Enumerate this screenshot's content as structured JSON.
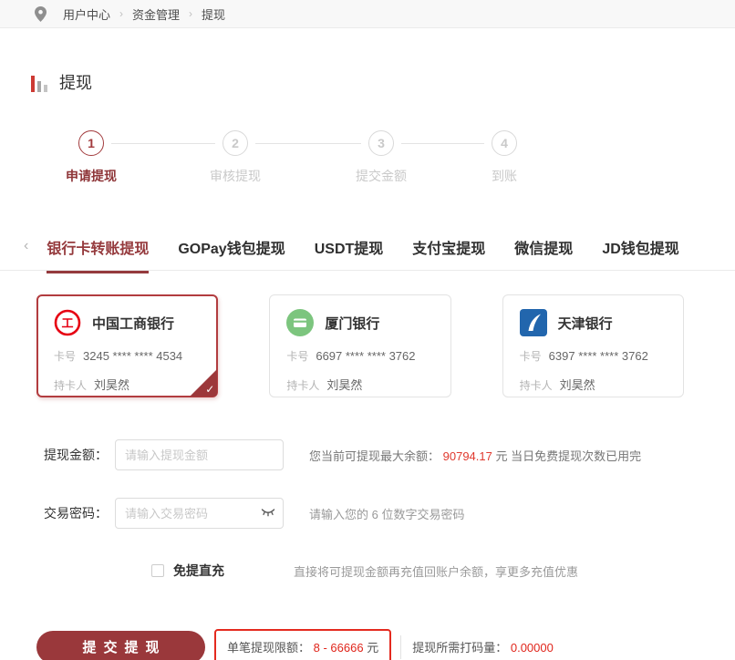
{
  "breadcrumb": {
    "items": [
      "用户中心",
      "资金管理",
      "提现"
    ],
    "separator": "›"
  },
  "page": {
    "title": "提现"
  },
  "stepper": {
    "steps": [
      {
        "num": "1",
        "label": "申请提现",
        "active": true
      },
      {
        "num": "2",
        "label": "审核提现",
        "active": false
      },
      {
        "num": "3",
        "label": "提交金额",
        "active": false
      },
      {
        "num": "4",
        "label": "到账",
        "active": false
      }
    ]
  },
  "tabs": {
    "back_arrow": "‹",
    "items": [
      {
        "label": "银行卡转账提现",
        "active": true
      },
      {
        "label": "GOPay钱包提现",
        "active": false
      },
      {
        "label": "USDT提现",
        "active": false
      },
      {
        "label": "支付宝提现",
        "active": false
      },
      {
        "label": "微信提现",
        "active": false
      },
      {
        "label": "JD钱包提现",
        "active": false
      }
    ]
  },
  "cards": [
    {
      "bank": "中国工商银行",
      "number_label": "卡号",
      "number": "3245 **** **** 4534",
      "holder_label": "持卡人",
      "holder": "刘昊然",
      "selected": true,
      "logo_color": "#e60012"
    },
    {
      "bank": "厦门银行",
      "number_label": "卡号",
      "number": "6697 **** **** 3762",
      "holder_label": "持卡人",
      "holder": "刘昊然",
      "selected": false,
      "logo_color": "#7cc57e"
    },
    {
      "bank": "天津银行",
      "number_label": "卡号",
      "number": "6397 **** **** 3762",
      "holder_label": "持卡人",
      "holder": "刘昊然",
      "selected": false,
      "logo_color": "#2266ad"
    }
  ],
  "check_glyph": "✓",
  "form": {
    "amount": {
      "label": "提现金额：",
      "placeholder": "请输入提现金额",
      "hint_prefix": "您当前可提现最大余额：",
      "hint_value": "90794.17",
      "hint_suffix": "元 当日免费提现次数已用完"
    },
    "password": {
      "label": "交易密码：",
      "placeholder": "请输入交易密码",
      "hint": "请输入您的 6 位数字交易密码"
    },
    "consent": {
      "label": "免提直充",
      "hint": "直接将可提现金额再充值回账户余额，享更多充值优惠",
      "checked": false
    }
  },
  "footer": {
    "submit_label": "提交提现",
    "limit_label": "单笔提现限额：",
    "limit_value": "8 - 66666",
    "limit_unit": "元",
    "code_label": "提现所需打码量：",
    "code_value": "0.00000"
  },
  "colors": {
    "brand_dark_red": "#9a383b",
    "active_tab_red": "#953a3d",
    "value_red": "#e0251b",
    "limit_border_red": "#e42a1f"
  }
}
